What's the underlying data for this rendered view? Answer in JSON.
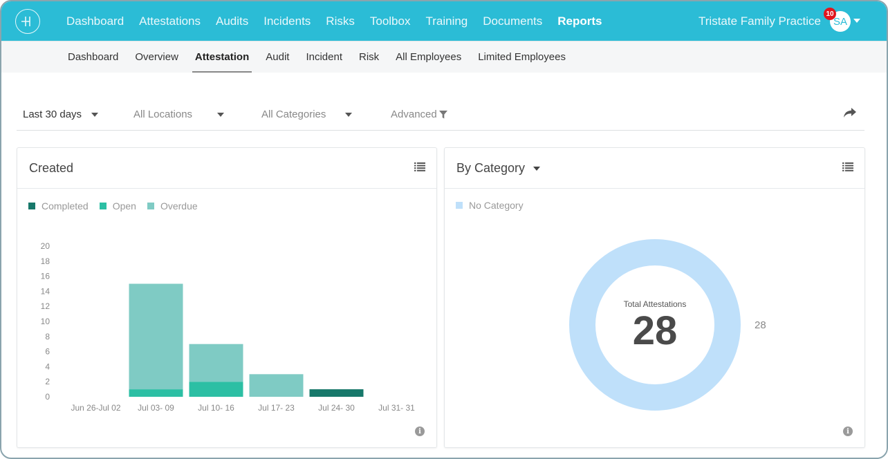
{
  "topnav": {
    "items": [
      {
        "label": "Dashboard",
        "active": false
      },
      {
        "label": "Attestations",
        "active": false
      },
      {
        "label": "Audits",
        "active": false
      },
      {
        "label": "Incidents",
        "active": false
      },
      {
        "label": "Risks",
        "active": false
      },
      {
        "label": "Toolbox",
        "active": false
      },
      {
        "label": "Training",
        "active": false
      },
      {
        "label": "Documents",
        "active": false
      },
      {
        "label": "Reports",
        "active": true
      }
    ],
    "org_name": "Tristate Family Practice",
    "avatar_initials": "SA",
    "notification_count": "10",
    "brand_color": "#2bbcd6"
  },
  "subnav": {
    "items": [
      {
        "label": "Dashboard",
        "active": false
      },
      {
        "label": "Overview",
        "active": false
      },
      {
        "label": "Attestation",
        "active": true
      },
      {
        "label": "Audit",
        "active": false
      },
      {
        "label": "Incident",
        "active": false
      },
      {
        "label": "Risk",
        "active": false
      },
      {
        "label": "All Employees",
        "active": false
      },
      {
        "label": "Limited Employees",
        "active": false
      }
    ]
  },
  "filters": {
    "date_range": "Last 30 days",
    "locations": "All Locations",
    "categories": "All Categories",
    "advanced": "Advanced"
  },
  "created_card": {
    "title": "Created"
  },
  "category_card": {
    "title": "By Category",
    "center_label": "Total Attestations",
    "center_value": "28"
  },
  "chart_data": [
    {
      "type": "bar",
      "stacked": true,
      "title": "Created",
      "categories": [
        "Jun 26-Jul 02",
        "Jul 03- 09",
        "Jul 10- 16",
        "Jul 17- 23",
        "Jul 24- 30",
        "Jul 31- 31"
      ],
      "series": [
        {
          "name": "Completed",
          "color": "#17786a",
          "values": [
            0,
            0,
            0,
            0,
            1,
            0
          ]
        },
        {
          "name": "Open",
          "color": "#2cbfa4",
          "values": [
            0,
            1,
            2,
            0,
            0,
            0
          ]
        },
        {
          "name": "Overdue",
          "color": "#7fcbc4",
          "values": [
            0,
            14,
            5,
            3,
            0,
            0
          ]
        }
      ],
      "yticks": [
        "0",
        "2",
        "4",
        "6",
        "8",
        "10",
        "12",
        "14",
        "16",
        "18",
        "20"
      ],
      "ylim": [
        0,
        20
      ],
      "xlabel": "",
      "ylabel": "",
      "grid": false,
      "legend": "top-left"
    },
    {
      "type": "pie",
      "donut": true,
      "title": "By Category",
      "slices": [
        {
          "label": "No Category",
          "value": 28,
          "color": "#bfe0fa"
        }
      ],
      "value_labels": [
        "28"
      ],
      "center_label": "Total Attestations",
      "center_value": "28",
      "legend": "top-left"
    }
  ]
}
